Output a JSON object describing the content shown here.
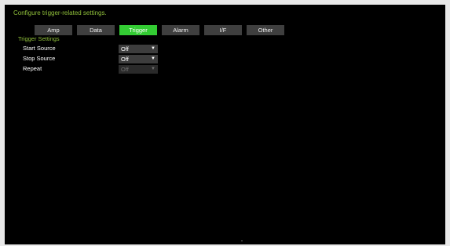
{
  "header": {
    "hint": "Configure trigger-related settings."
  },
  "tabs": [
    {
      "label": "Amp",
      "active": false
    },
    {
      "label": "Data",
      "active": false
    },
    {
      "label": "Trigger",
      "active": true
    },
    {
      "label": "Alarm",
      "active": false
    },
    {
      "label": "I/F",
      "active": false
    },
    {
      "label": "Other",
      "active": false
    }
  ],
  "trigger_settings": {
    "title": "Trigger Settings",
    "rows": [
      {
        "label": "Start Source",
        "value": "Off",
        "enabled": true
      },
      {
        "label": "Stop Source",
        "value": "Off",
        "enabled": true
      },
      {
        "label": "Repeat",
        "value": "Off",
        "enabled": false
      }
    ]
  },
  "colors": {
    "accent_text": "#8fbf3a",
    "active_tab": "#33cc33",
    "tab_bg": "#3f3f3f",
    "screen_bg": "#000000"
  },
  "icons": {
    "dropdown": "chevron-down-icon"
  }
}
